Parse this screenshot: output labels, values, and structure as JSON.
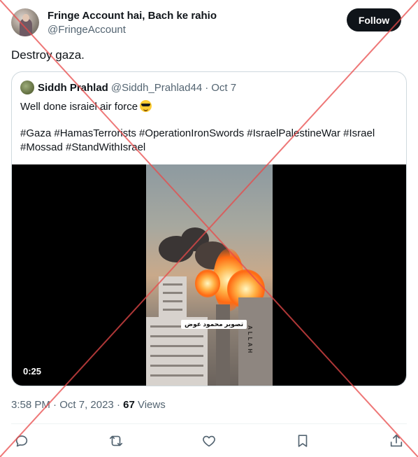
{
  "author": {
    "display_name": "Fringe Account hai, Bach ke rahio",
    "handle": "@FringeAccount"
  },
  "follow_label": "Follow",
  "tweet_text": "Destroy gaza.",
  "quoted_tweet": {
    "display_name": "Siddh Prahlad",
    "handle": "@Siddh_Prahlad44",
    "separator": "·",
    "date": "Oct 7",
    "text": "Well done israiel air force",
    "emoji": "smiling-face-with-sunglasses",
    "hashtags": "#Gaza #HamasTerrorists #OperationIronSwords #IsraelPalestineWar #Israel #Mossad #StandWithIsrael",
    "video": {
      "duration": "0:25",
      "caption": "تصوير محمود عوض",
      "building_text": "ALLAH"
    }
  },
  "meta": {
    "time": "3:58 PM",
    "separator": "·",
    "date": "Oct 7, 2023",
    "dot": "·",
    "views_count": "67",
    "views_label": "Views"
  },
  "actions": [
    "reply-icon",
    "retweet-icon",
    "like-icon",
    "bookmark-icon",
    "share-icon"
  ],
  "colors": {
    "follow_button_bg": "#0f1419",
    "secondary_text": "#536471",
    "cross_overlay": "#e84a4a"
  }
}
